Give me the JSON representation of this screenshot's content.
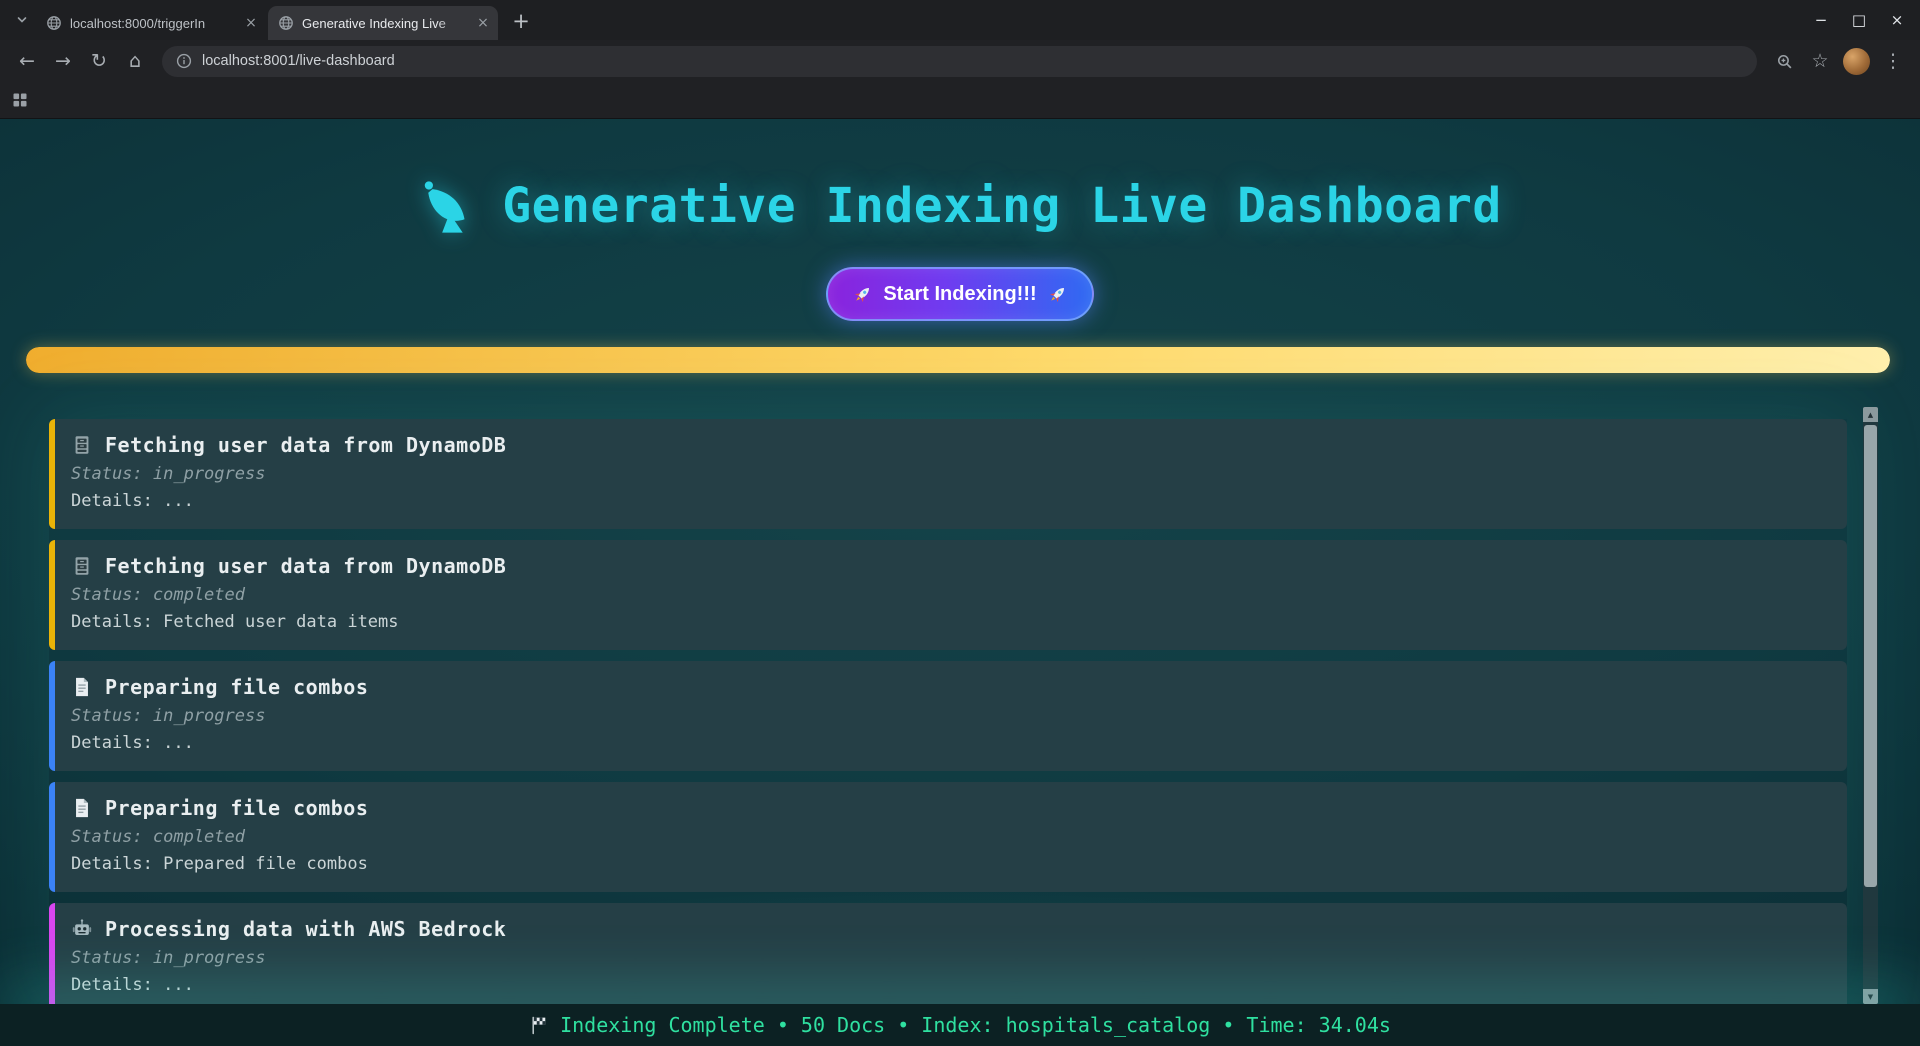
{
  "browser": {
    "tab_search_icon": "chevron-down-icon",
    "tabs": [
      {
        "title": "localhost:8000/triggerIn",
        "favicon": "globe-icon",
        "close_label": "×"
      },
      {
        "title": "Generative Indexing Live",
        "favicon": "globe-icon",
        "close_label": "×"
      }
    ],
    "new_tab_label": "+",
    "window_controls": {
      "minimize": "−",
      "maximize": "□",
      "close": "×"
    },
    "toolbar": {
      "back": "←",
      "forward": "→",
      "reload": "↻",
      "home": "⌂",
      "info_icon": "info-icon",
      "url": "localhost:8001/live-dashboard",
      "zoom_icon": "lens-icon",
      "bookmark_star": "☆",
      "menu": "⋮"
    },
    "apps_icon": "grid-icon"
  },
  "page": {
    "header": {
      "icon": "satellite-dish-icon",
      "title": "Generative Indexing Live Dashboard",
      "accent_color": "#2bd4e6"
    },
    "start_button": {
      "left_icon": "rocket-icon",
      "label": "Start Indexing!!!",
      "right_icon": "rocket-icon"
    },
    "progress_bar": {
      "percent": 100,
      "gradient": [
        "#f0ad2e",
        "#ffd96a",
        "#ffefad"
      ]
    },
    "events": [
      {
        "icon": "cabinet-icon",
        "accent_color": "#eab308",
        "title": "Fetching user data from DynamoDB",
        "status": "Status: in_progress",
        "details": "Details: ..."
      },
      {
        "icon": "cabinet-icon",
        "accent_color": "#eab308",
        "title": "Fetching user data from DynamoDB",
        "status": "Status: completed",
        "details": "Details: Fetched user data items"
      },
      {
        "icon": "document-icon",
        "accent_color": "#3b82f6",
        "title": "Preparing file combos",
        "status": "Status: in_progress",
        "details": "Details: ..."
      },
      {
        "icon": "document-icon",
        "accent_color": "#3b82f6",
        "title": "Preparing file combos",
        "status": "Status: completed",
        "details": "Details: Prepared file combos"
      },
      {
        "icon": "robot-icon",
        "accent_color": "#d946ef",
        "title": "Processing data with AWS Bedrock",
        "status": "Status: in_progress",
        "details": "Details: ..."
      }
    ],
    "status_bar": {
      "icon": "checkered-flag-icon",
      "text": "Indexing Complete • 50 Docs • Index: hospitals_catalog • Time: 34.04s",
      "accent_color": "#2fe0a0"
    }
  }
}
